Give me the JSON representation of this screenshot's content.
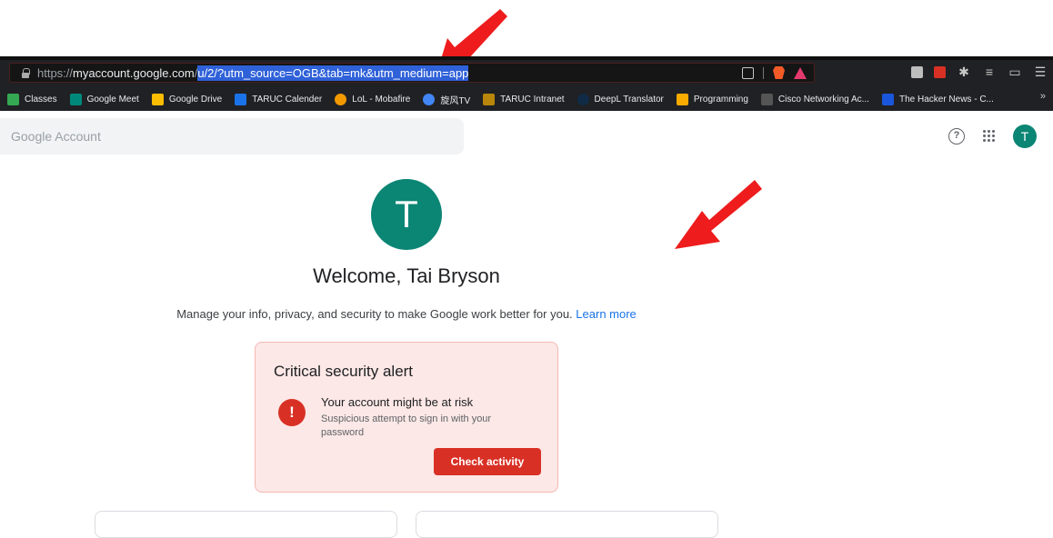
{
  "browser": {
    "url_scheme": "https://",
    "url_domain": "myaccount.google.com",
    "url_slash": "/",
    "url_selected": "u/2/?utm_source=OGB&tab=mk&utm_medium=app"
  },
  "bookmarks": [
    {
      "label": "Classes",
      "color": "#34a853"
    },
    {
      "label": "Google Meet",
      "color": "#00897b"
    },
    {
      "label": "Google Drive",
      "color": "#fbbc04"
    },
    {
      "label": "TARUC Calender",
      "color": "#1a73e8"
    },
    {
      "label": "LoL - Mobafire",
      "color": "#f29900"
    },
    {
      "label": "旋风TV",
      "color": "#4285f4"
    },
    {
      "label": "TARUC Intranet",
      "color": "#b8860b"
    },
    {
      "label": "DeepL Translator",
      "color": "#0f2b46"
    },
    {
      "label": "Programming",
      "color": "#f9ab00"
    },
    {
      "label": "Cisco Networking Ac...",
      "color": "#555555"
    },
    {
      "label": "The Hacker News - C...",
      "color": "#1a56db"
    }
  ],
  "header": {
    "search_placeholder": "Google Account",
    "help_glyph": "?",
    "avatar_initial": "T"
  },
  "profile": {
    "avatar_initial": "T",
    "welcome": "Welcome, Tai Bryson",
    "manage_text": "Manage your info, privacy, and security to make Google work better for you.",
    "learn_more": "Learn more"
  },
  "alert": {
    "title": "Critical security alert",
    "icon_glyph": "!",
    "headline": "Your account might be at risk",
    "subtext": "Suspicious attempt to sign in with your password",
    "button": "Check activity"
  },
  "colors": {
    "accent_teal": "#0b8574",
    "alert_red": "#d93025",
    "arrow_red": "#ee1c1c"
  }
}
